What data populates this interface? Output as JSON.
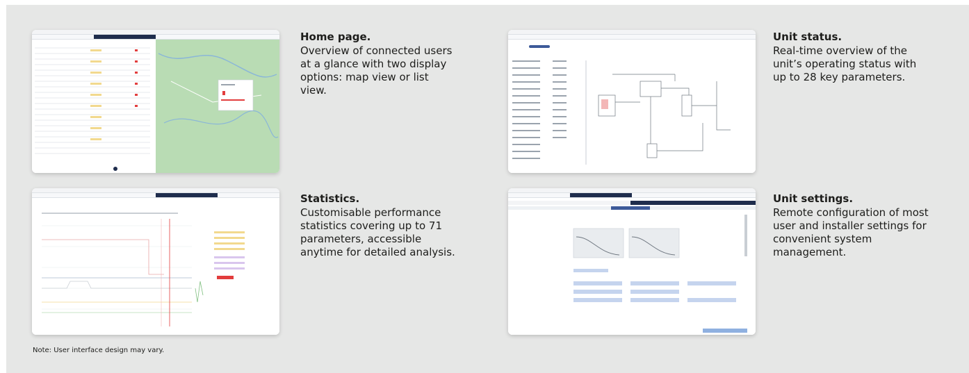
{
  "home": {
    "title": "Home page.",
    "text": "Overview of connected users at a glance with two display options: map view or list view."
  },
  "unit_status": {
    "title": "Unit status.",
    "text": "Real-time overview of the unit’s operating status with up to 28 key parameters."
  },
  "statistics": {
    "title": "Statistics.",
    "text": "Customisable performance statistics covering up to 71 parameters, accessible anytime for detailed analysis."
  },
  "unit_settings": {
    "title": "Unit settings.",
    "text": "Remote configuration of most user and installer settings for convenient system management."
  },
  "note": "Note: User interface design may vary.",
  "colors": {
    "panel_bg": "#e6e7e6",
    "nav_active": "#1f2d4d",
    "map_green": "#b9dcb4",
    "accent_red": "#e23d3d"
  }
}
